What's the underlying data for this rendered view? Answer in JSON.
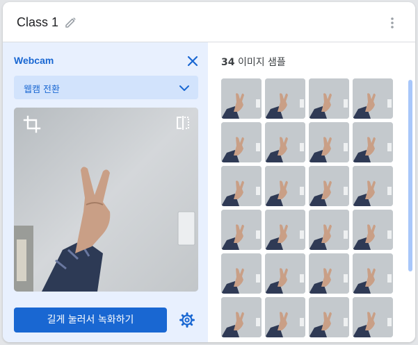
{
  "header": {
    "title": "Class 1"
  },
  "webcam": {
    "title": "Webcam",
    "switch_label": "웹캠 전환"
  },
  "record": {
    "label": "길게 눌러서 녹화하기"
  },
  "samples": {
    "count": "34",
    "label": "이미지 샘플",
    "thumbnail_count": 24
  },
  "colors": {
    "accent": "#1967d2",
    "panel_bg": "#e8f0fe",
    "select_bg": "#d2e3fc"
  },
  "icons": [
    "edit-icon",
    "more-vert-icon",
    "close-icon",
    "chevron-down-icon",
    "crop-icon",
    "flip-icon",
    "settings-icon"
  ]
}
